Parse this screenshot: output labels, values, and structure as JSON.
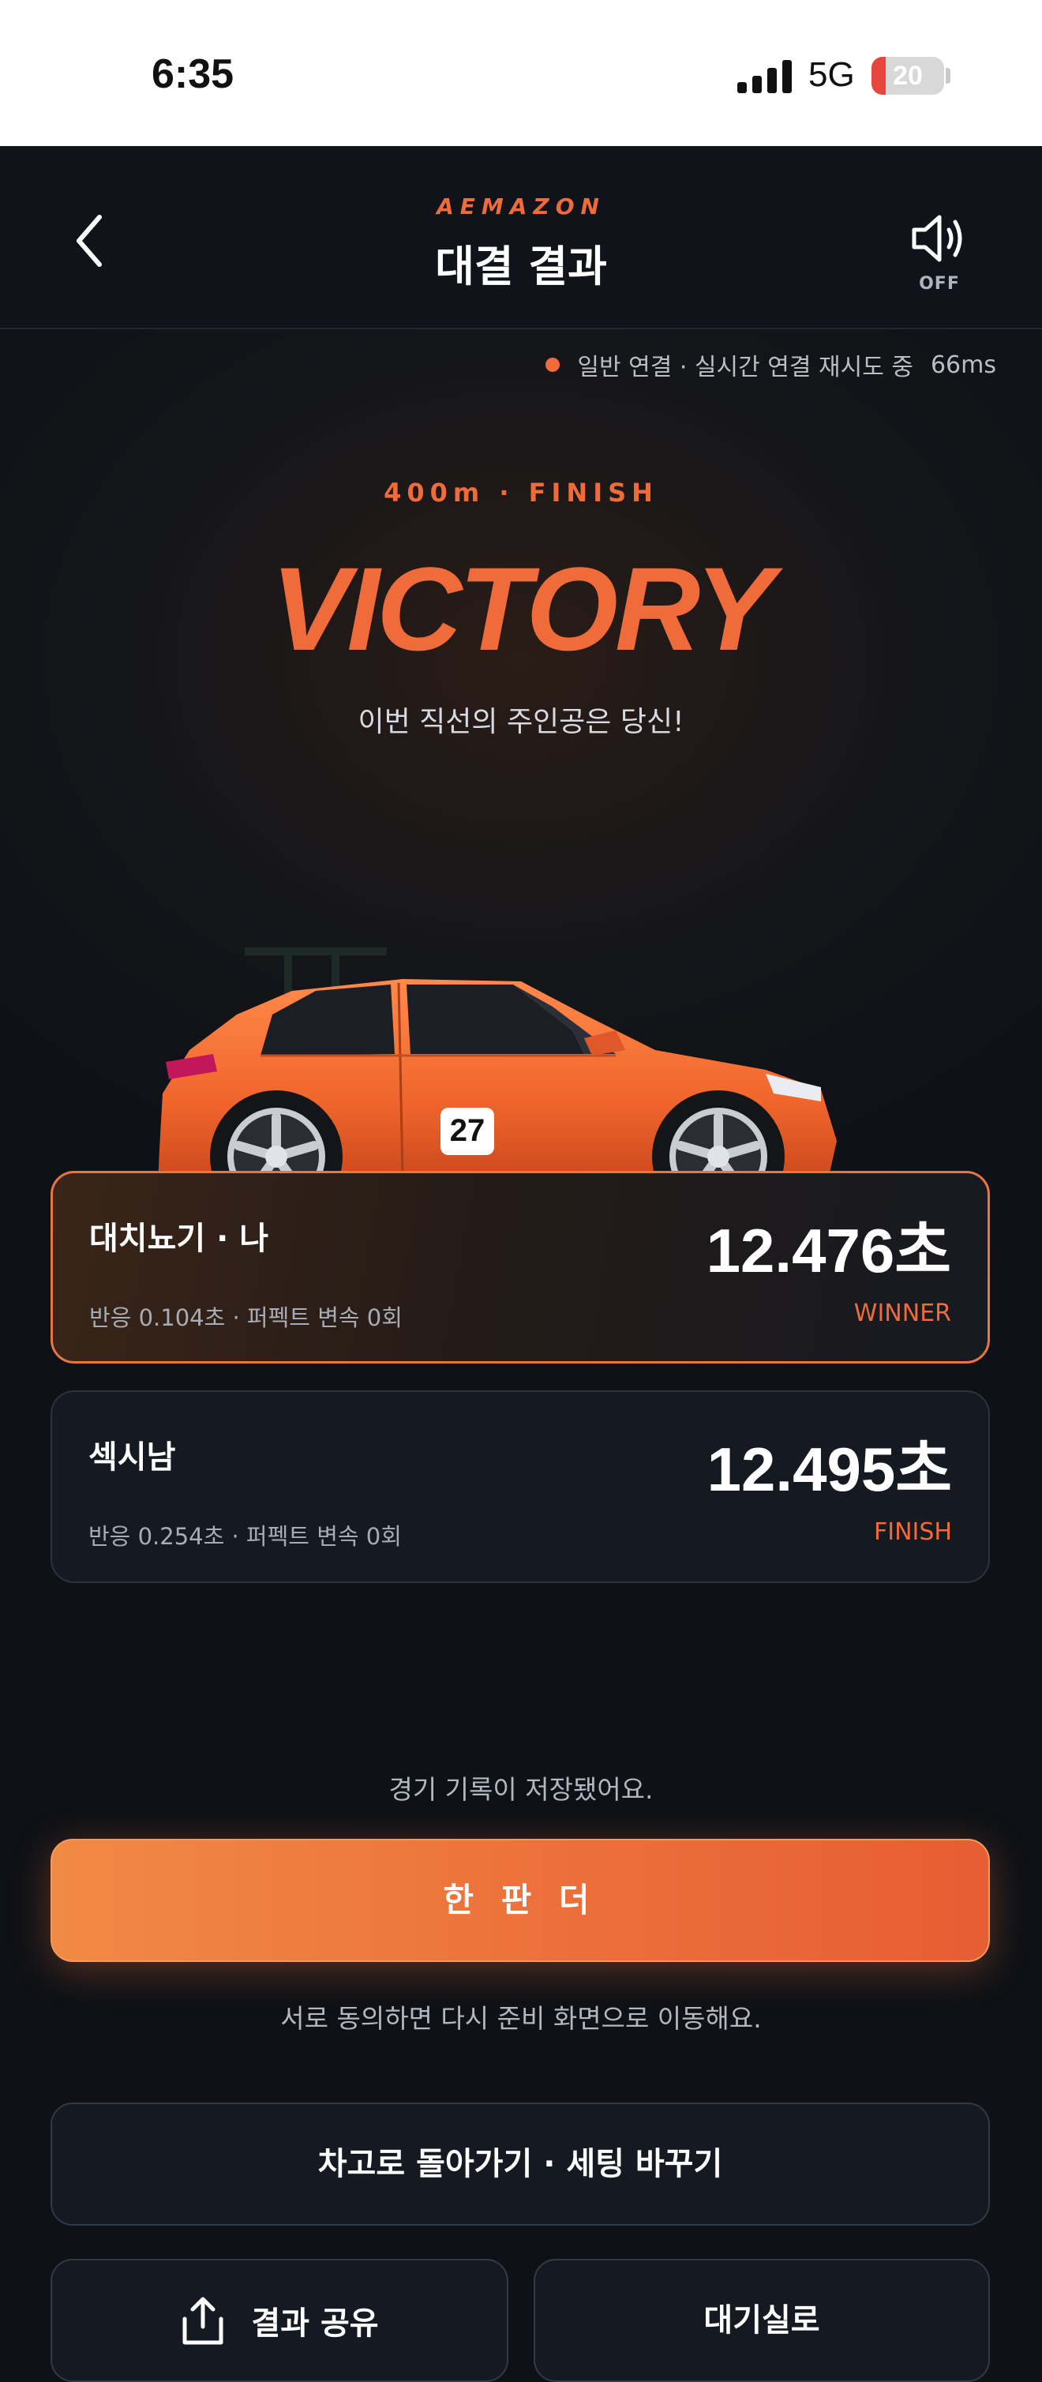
{
  "status_bar": {
    "time": "6:35",
    "network": "5G",
    "battery": "20",
    "battery_level": 0.2
  },
  "header": {
    "brand": "AEMAZON",
    "title": "대결 결과",
    "sound_label": "OFF",
    "icons": {
      "back": "chevron-left-icon",
      "sound": "speaker-icon"
    }
  },
  "connection": {
    "status": "일반 연결 · 실시간 연결 재시도 중",
    "latency": "66ms",
    "dot_color": "#ef6b3a"
  },
  "result": {
    "distance": "400m · FINISH",
    "headline": "VICTORY",
    "subtitle": "이번 직선의 주인공은 당신!",
    "car_number": "27"
  },
  "racers": [
    {
      "name": "대치뇨기 · 나",
      "time": "12.476초",
      "stats": "반응 0.104초 · 퍼펙트 변속 0회",
      "badge": "WINNER"
    },
    {
      "name": "섹시남",
      "time": "12.495초",
      "stats": "반응 0.254초 · 퍼펙트 변속 0회",
      "badge": "FINISH"
    }
  ],
  "saved_message": "경기 기록이 저장됐어요.",
  "rematch_button": "한 판 더",
  "rematch_hint": "서로 동의하면 다시 준비 화면으로 이동해요.",
  "garage_button": "차고로 돌아가기 · 세팅 바꾸기",
  "share_button": "결과 공유",
  "lobby_button": "대기실로",
  "colors": {
    "accent": "#ef6b3a",
    "background": "#0e1116",
    "card": "#151a22"
  }
}
